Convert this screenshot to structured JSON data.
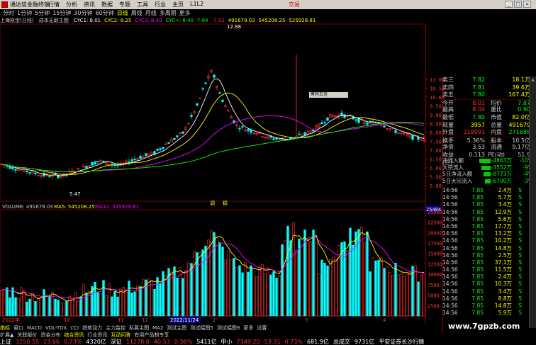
{
  "window": {
    "title": "通达信金融终端",
    "menu": [
      "行情",
      "分析",
      "资讯",
      "数据",
      "专题",
      "工具",
      "行业",
      "主页",
      "L1L2"
    ],
    "trade": "交易"
  },
  "periods": [
    {
      "label": "分时",
      "active": false
    },
    {
      "label": "1分钟",
      "active": false
    },
    {
      "label": "5分钟",
      "active": false
    },
    {
      "label": "15分钟",
      "active": false
    },
    {
      "label": "30分钟",
      "active": false
    },
    {
      "label": "60分钟",
      "active": false
    },
    {
      "label": "日线",
      "active": true
    },
    {
      "label": "周线",
      "active": false
    },
    {
      "label": "月线",
      "active": false
    },
    {
      "label": "多周期",
      "active": false
    },
    {
      "label": "更多",
      "active": false
    }
  ],
  "indicator_bar": {
    "stock": "上海凯宝(日线)",
    "formula": "成本无敌主图",
    "items": [
      {
        "text": "CYC1: 8.01",
        "color": "#ffffff"
      },
      {
        "text": "CYC2: 8.25",
        "color": "#ffff00"
      },
      {
        "text": "CYC3: 8.49",
        "color": "#ff00ff"
      },
      {
        "text": "CYC∞: 8.40",
        "color": "#00ff00"
      },
      {
        "text": "7.84",
        "color": "#00ff00"
      },
      {
        "text": "-7.92",
        "color": "#ff3030"
      },
      {
        "text": "491679.03",
        "color": "#ffff00"
      },
      {
        "text": "545208.25",
        "color": "#ffff00"
      },
      {
        "text": "525928.81",
        "color": "#ffff00"
      }
    ]
  },
  "price_axis": [
    "11.00",
    "10.50",
    "10.00",
    "9.50",
    "9.00",
    "8.50",
    "8.00",
    "7.50",
    "7.00",
    "6.50",
    "6.00",
    "5.50",
    "5.00"
  ],
  "peak_label": "12.88",
  "low_label": "5.47",
  "markers": [
    "调",
    "稳"
  ],
  "volume_bar": {
    "title": "VOLUME: 491679.03",
    "ma5": "MA5: 545208.25",
    "ma10": "MA10: 525928.81"
  },
  "volume_axis": [
    "25484",
    "25000",
    "22500",
    "20000",
    "17500",
    "15000",
    "12500",
    "10000",
    "7500",
    "5000",
    "2500"
  ],
  "date_axis": [
    "2022年",
    "10",
    "11",
    "12",
    "2022/11/24",
    "2",
    "3",
    "4"
  ],
  "float_label": "筹码五览",
  "quote": [
    {
      "l": "卖三",
      "v": "7.82",
      "c": "#0f0",
      "n": "18.1万",
      "nc": "#ff0"
    },
    {
      "l": "卖四",
      "v": "7.81",
      "c": "#0f0",
      "n": "39.6万",
      "nc": "#ff0"
    },
    {
      "l": "卖五",
      "v": "7.80",
      "c": "#0f0",
      "n": "167.4万",
      "nc": "#ff0"
    },
    {
      "l": "今开",
      "v": "8.01",
      "c": "#ff3030",
      "l2": "均价",
      "n": "7.87",
      "nc": "#0f0"
    },
    {
      "l": "最高",
      "v": "8.04",
      "c": "#ff3030",
      "l2": "量比",
      "n": "0.90",
      "nc": "#0f0"
    },
    {
      "l": "最低",
      "v": "7.80",
      "c": "#0f0",
      "l2": "市值",
      "n": "82.0亿",
      "nc": "#ff0"
    },
    {
      "l": "现量",
      "v": "3957",
      "c": "#ff0",
      "l2": "总量",
      "n": "491679",
      "nc": "#ff0"
    },
    {
      "l": "外盘",
      "v": "219991",
      "c": "#ff3030",
      "l2": "内盘",
      "n": "271688",
      "nc": "#0f0"
    },
    {
      "l": "换手",
      "v": "5.36%",
      "c": "#ccc",
      "l2": "股本",
      "n": "10.5亿",
      "nc": "#ccc"
    },
    {
      "l": "净资",
      "v": "3.53",
      "c": "#ccc",
      "l2": "流通",
      "n": "9.17亿",
      "nc": "#ccc"
    },
    {
      "l": "收益(三)",
      "v": "0.113",
      "c": "#ccc",
      "l2": "PE(动)",
      "n": "51.9",
      "nc": "#ccc"
    }
  ],
  "flow": [
    {
      "label": "净流入额",
      "value": "-4863万",
      "pct": "-10%",
      "w": 16
    },
    {
      "label": "大宗流入",
      "value": "-3552万",
      "pct": "-9%",
      "w": 13
    },
    {
      "label": "5日净流入额",
      "value": "-8773万",
      "pct": "-4%",
      "w": 10
    },
    {
      "label": "5日大宗流入",
      "value": "-6700万",
      "pct": "-3%",
      "w": 8
    }
  ],
  "ticks": [
    {
      "t": "14:56",
      "p": "7.85",
      "v": "2.4万",
      "d": "S"
    },
    {
      "t": "14:56",
      "p": "7.85",
      "v": "5.7万",
      "d": "S"
    },
    {
      "t": "14:56",
      "p": "7.85",
      "v": "3.4万",
      "d": "S"
    },
    {
      "t": "14:56",
      "p": "7.85",
      "v": "12.9万",
      "d": "S"
    },
    {
      "t": "14:56",
      "p": "7.85",
      "v": "5.6万",
      "d": "S"
    },
    {
      "t": "14:56",
      "p": "7.85",
      "v": "17.7万",
      "d": "S"
    },
    {
      "t": "14:56",
      "p": "7.85",
      "v": "13.2万",
      "d": "S"
    },
    {
      "t": "14:56",
      "p": "7.85",
      "v": "10.2万",
      "d": "S"
    },
    {
      "t": "14:56",
      "p": "7.85",
      "v": "14.8万",
      "d": "S"
    },
    {
      "t": "14:56",
      "p": "7.85",
      "v": "2.5万",
      "d": "S"
    },
    {
      "t": "14:56",
      "p": "7.85",
      "v": "37.1万",
      "d": "S"
    },
    {
      "t": "14:56",
      "p": "7.85",
      "v": "11.5万",
      "d": "S"
    },
    {
      "t": "14:56",
      "p": "7.85",
      "v": "2.4万",
      "d": "S"
    },
    {
      "t": "14:56",
      "p": "7.85",
      "v": "10.3万",
      "d": "S"
    },
    {
      "t": "14:56",
      "p": "7.85",
      "v": "3.4万",
      "d": "S"
    },
    {
      "t": "14:56",
      "p": "7.85",
      "v": "8.8万",
      "d": "S"
    },
    {
      "t": "14:56",
      "p": "7.85",
      "v": "14.8万",
      "d": "S"
    },
    {
      "t": "14:56",
      "p": "7.85",
      "v": "5.9万",
      "d": "S"
    }
  ],
  "bottom_tabs_row1": [
    "指标",
    "窗口",
    "MACD",
    "VOL-TDX",
    "CCI",
    "趋势动力",
    "主力监控",
    "私募主图",
    "MA2",
    "测试主图",
    "测试幅图5",
    "测试幅图9",
    "更多",
    "设置"
  ],
  "bottom_tabs_row2": [
    "扩展▲",
    "关联报价",
    "资金分布",
    "综合资讯",
    "行业资讯",
    "互动问答",
    "有用产品制专享"
  ],
  "bottom_tabs_row2_hl": [
    "综合资讯",
    "互动问答"
  ],
  "statusbar": {
    "sh_label": "上证",
    "sh_val": "3250.55",
    "sh_chg": "23.66",
    "sh_pct": "0.73%",
    "sh_amt": "4320亿",
    "sz_label": "深证",
    "sz_val": "11278.0",
    "sz_chg": "40.53",
    "sz_pct": "0.36%",
    "sz_amt": "5411亿",
    "zx_label": "中小",
    "zx_val": "7349.20",
    "zx_chg": "53.31",
    "zx_pct": "0.73%",
    "zx_amt": "681.9亿",
    "total_label": "总成交",
    "total_amt": "9731亿",
    "news": "平安证券长沙行情"
  },
  "watermark": "www.7gpzb.com",
  "colors": {
    "up": "#ff3030",
    "down": "#00ffff",
    "bg": "#000000"
  }
}
